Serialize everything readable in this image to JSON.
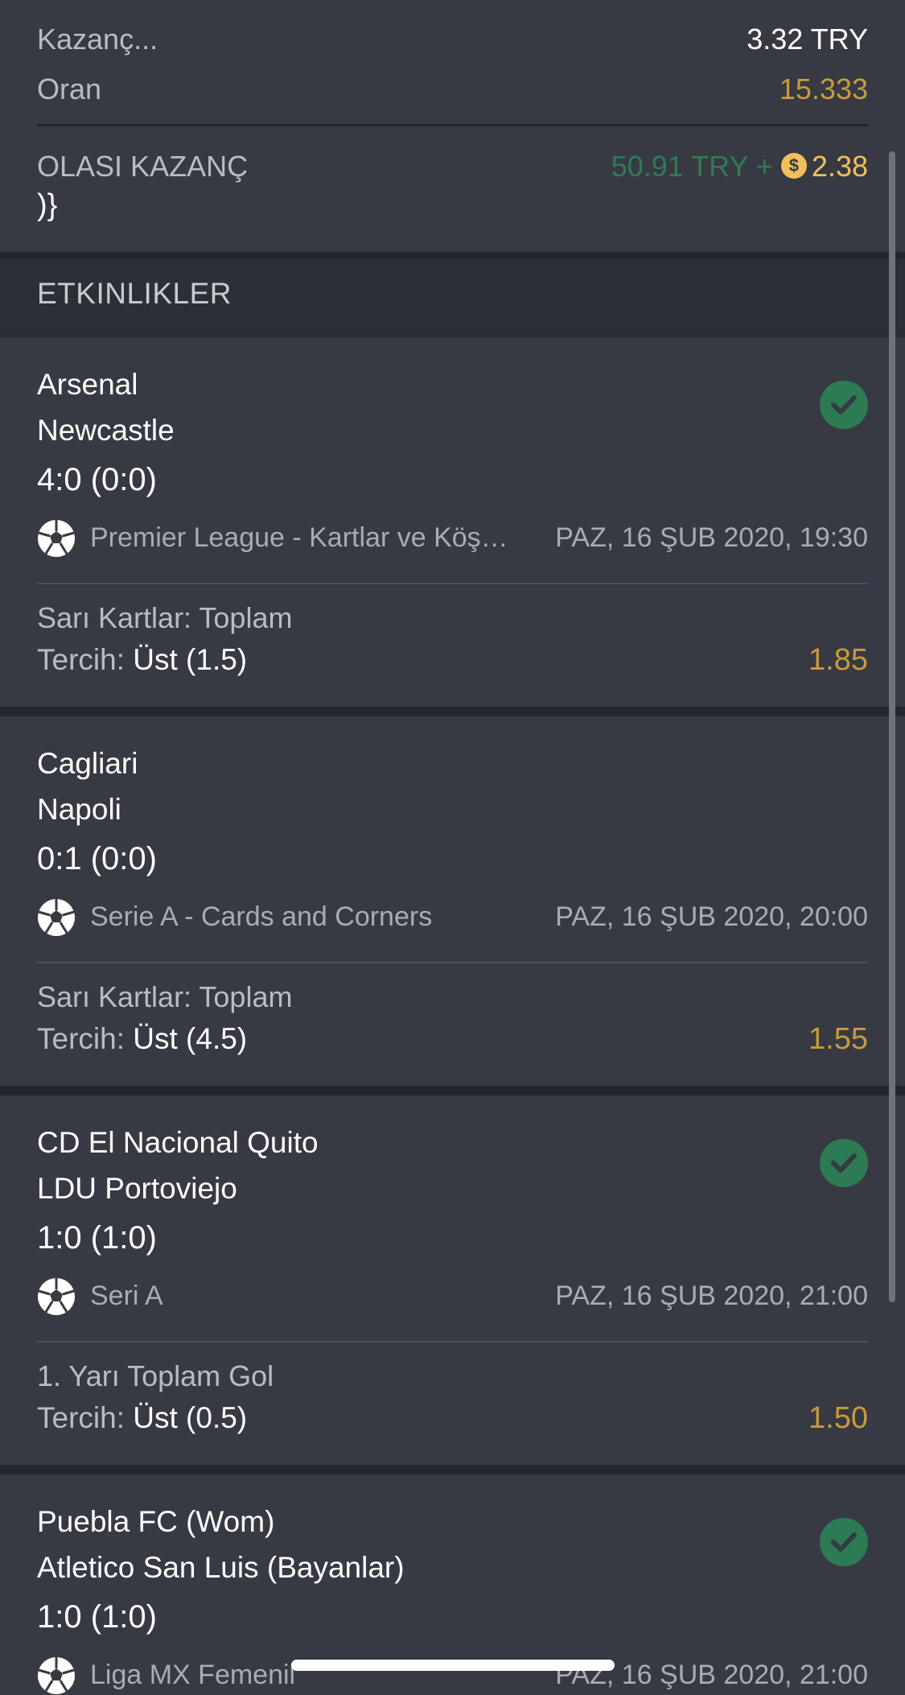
{
  "summary": {
    "stake_label": "Kazanç...",
    "stake_value": "3.32 TRY",
    "odds_label": "Oran",
    "odds_value": "15.333",
    "potential_label": "OLASI KAZANÇ",
    "potential_value": "50.91 TRY +",
    "bonus_value": "2.38",
    "stray_text": ")}"
  },
  "section_title": "ETKINLIKLER",
  "pick_label": "Tercih:",
  "events": [
    {
      "team1": "Arsenal",
      "team2": "Newcastle",
      "score": "4:0 (0:0)",
      "league": "Premier League - Kartlar ve Köşe Vuruşları",
      "date": "PAZ, 16 ŞUB 2020, 19:30",
      "market": "Sarı Kartlar: Toplam",
      "selection": "Üst (1.5)",
      "odds": "1.85",
      "won": true
    },
    {
      "team1": "Cagliari",
      "team2": "Napoli",
      "score": "0:1 (0:0)",
      "league": "Serie A - Cards and Corners",
      "date": "PAZ, 16 ŞUB 2020, 20:00",
      "market": "Sarı Kartlar: Toplam",
      "selection": "Üst (4.5)",
      "odds": "1.55",
      "won": false
    },
    {
      "team1": "CD El Nacional Quito",
      "team2": "LDU Portoviejo",
      "score": "1:0 (1:0)",
      "league": "Seri A",
      "date": "PAZ, 16 ŞUB 2020, 21:00",
      "market": "1. Yarı Toplam Gol",
      "selection": "Üst (0.5)",
      "odds": "1.50",
      "won": true
    },
    {
      "team1": "Puebla FC (Wom)",
      "team2": "Atletico San Luis (Bayanlar)",
      "score": "1:0 (1:0)",
      "league": "Liga MX Femenil",
      "date": "PAZ, 16 ŞUB 2020, 21:00",
      "won": true
    }
  ]
}
